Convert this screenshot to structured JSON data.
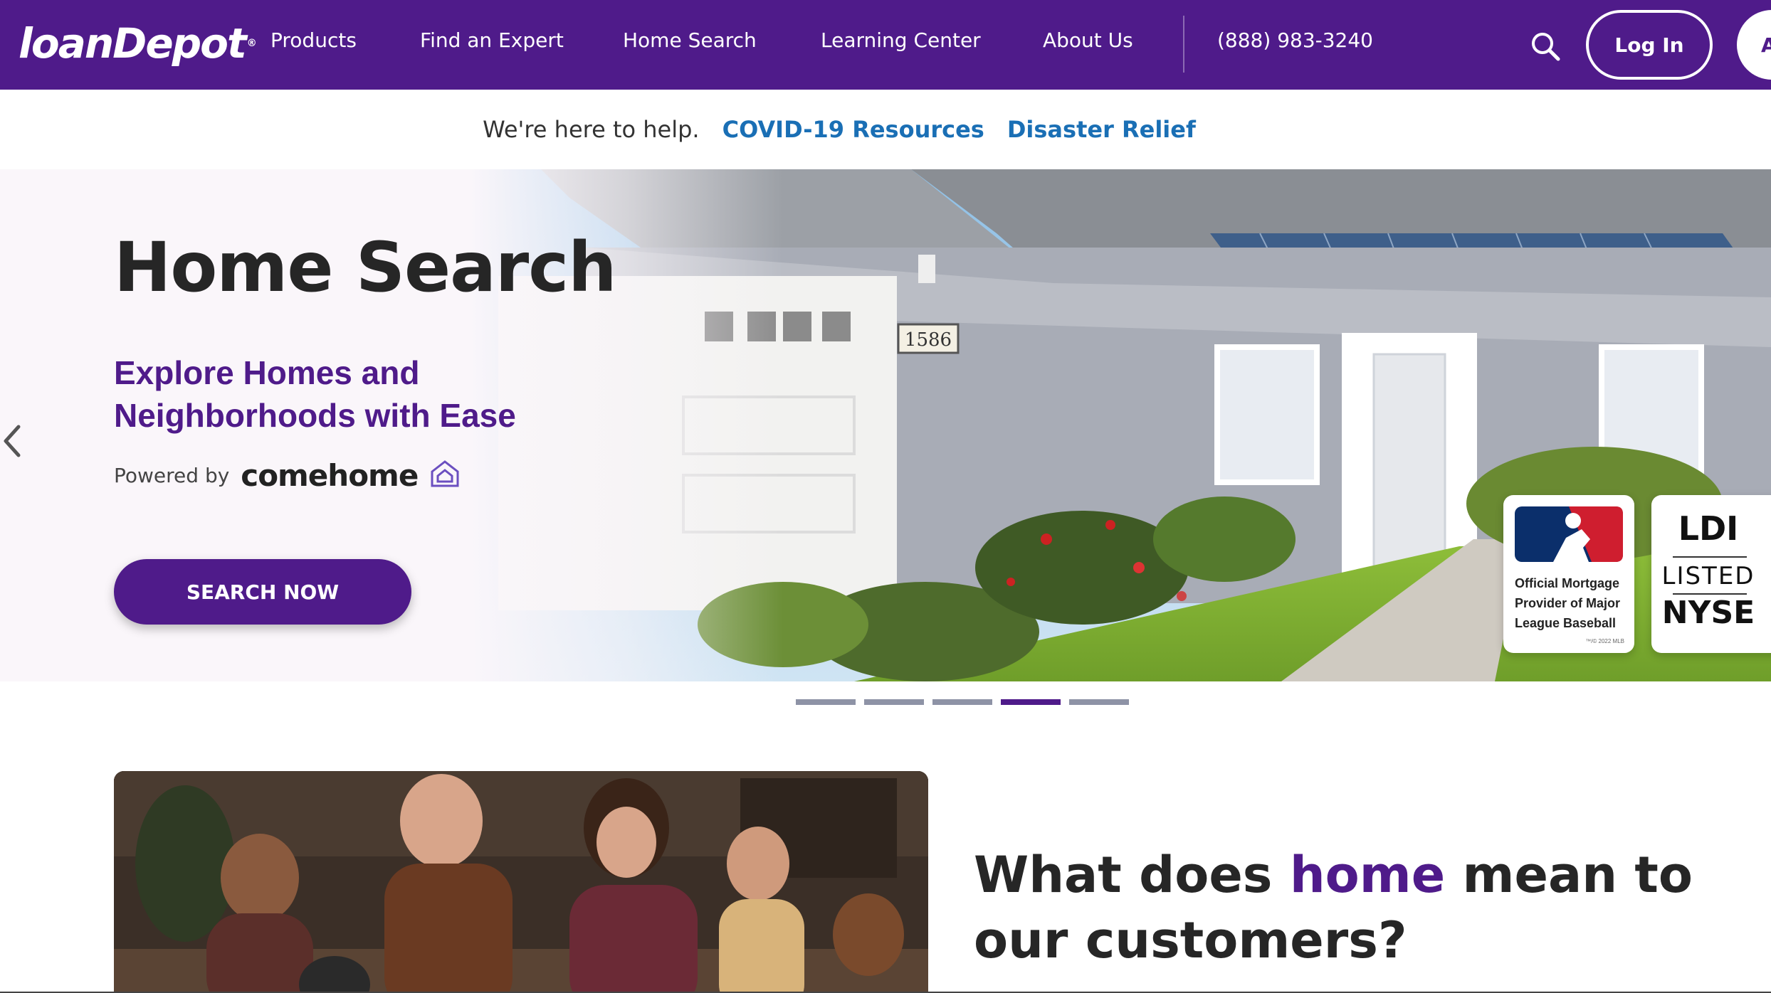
{
  "header": {
    "logo_text_a": "loan",
    "logo_text_b": "Depot",
    "logo_mark": "®",
    "nav": [
      "Products",
      "Find an Expert",
      "Home Search",
      "Learning Center",
      "About Us"
    ],
    "phone": "(888) 983-3240",
    "search_icon": "search-icon",
    "login_label": "Log In",
    "apply_label": "A"
  },
  "helpbar": {
    "text": "We're here to help.",
    "link_covid": "COVID-19 Resources",
    "link_disaster": "Disaster Relief"
  },
  "hero": {
    "title": "Home Search",
    "subtitle": "Explore Homes and Neighborhoods with Ease",
    "powered_label": "Powered by",
    "powered_brand": "comehome",
    "cta": "SEARCH NOW",
    "house_number": "1586",
    "badge_mlb_text": "Official Mortgage Provider of Major League Baseball",
    "badge_mlb_tm": "™/© 2022 MLB",
    "badge_ldi_line1": "LDI",
    "badge_ldi_line2": "LISTED",
    "badge_ldi_line3": "NYSE"
  },
  "carousel": {
    "slide_count": 5,
    "active_index": 3
  },
  "lower": {
    "heading_pre": "What does ",
    "heading_highlight": "home",
    "heading_post": " mean to our customers?"
  },
  "colors": {
    "brand_purple": "#4f1b8a",
    "link_blue": "#1a6fb5",
    "logo_green": "#9bd23c",
    "indicator_gray": "#8e93a6"
  }
}
